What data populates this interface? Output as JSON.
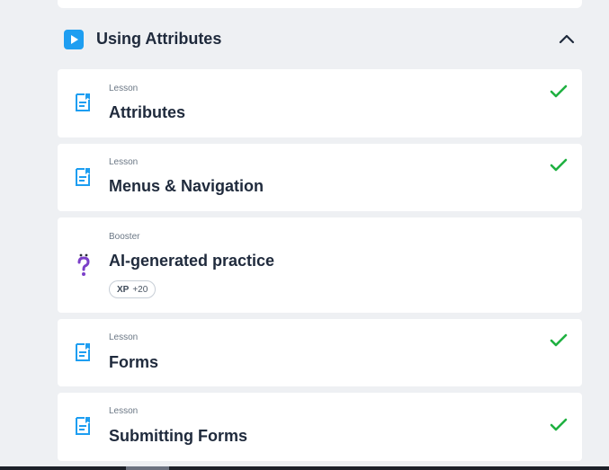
{
  "section": {
    "title": "Using Attributes",
    "icon": "play-icon",
    "accent": "#1e9ef1"
  },
  "items": [
    {
      "type": "Lesson",
      "title": "Attributes",
      "icon": "lesson-document-icon",
      "completed": true
    },
    {
      "type": "Lesson",
      "title": "Menus & Navigation",
      "icon": "lesson-document-icon",
      "completed": true
    },
    {
      "type": "Booster",
      "title": "AI-generated practice",
      "icon": "question-mark-icon",
      "xp_label": "XP",
      "xp_value": "+20",
      "completed": false
    },
    {
      "type": "Lesson",
      "title": "Forms",
      "icon": "lesson-document-icon",
      "completed": true
    },
    {
      "type": "Lesson",
      "title": "Submitting Forms",
      "icon": "lesson-document-icon",
      "completed": true
    }
  ],
  "colors": {
    "check": "#1fb141",
    "lesson_icon": "#1e9ef1",
    "booster_icon": "#7b3fc9"
  }
}
